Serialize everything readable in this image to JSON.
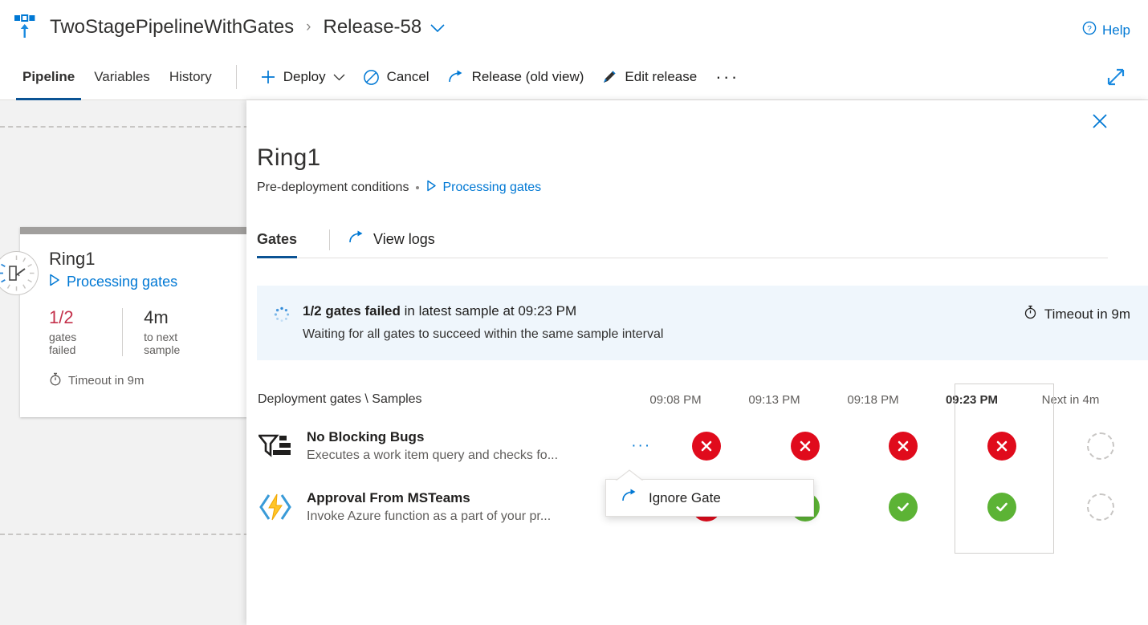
{
  "header": {
    "pipeline_icon": "release-pipeline-icon",
    "pipeline_name": "TwoStagePipelineWithGates",
    "separator": "›",
    "release_name": "Release-58",
    "help_label": "Help",
    "help_icon": "question-circle-icon"
  },
  "toolbar": {
    "tabs": [
      {
        "label": "Pipeline",
        "active": true
      },
      {
        "label": "Variables",
        "active": false
      },
      {
        "label": "History",
        "active": false
      }
    ],
    "buttons": [
      {
        "label": "Deploy",
        "icon": "plus-icon",
        "has_chevron": true
      },
      {
        "label": "Cancel",
        "icon": "cancel-circle-icon",
        "has_chevron": false
      },
      {
        "label": "Release (old view)",
        "icon": "arrow-redo-icon",
        "has_chevron": false
      },
      {
        "label": "Edit release",
        "icon": "pencil-icon",
        "has_chevron": false
      }
    ],
    "overflow_label": "···",
    "expand_icon": "expand-diagonal-icon"
  },
  "stage_card": {
    "badge_icon": "gate-processing-icon",
    "title": "Ring1",
    "status_label": "Processing gates",
    "status_icon": "play-triangle-icon",
    "metrics": [
      {
        "value": "1/2",
        "label": "gates failed",
        "tone": "red"
      },
      {
        "value": "4m",
        "label": "to next sample",
        "tone": "plain"
      }
    ],
    "timeout_icon": "timer-icon",
    "timeout_label": "Timeout in 9m"
  },
  "panel": {
    "close_icon": "close-icon",
    "title": "Ring1",
    "subtitle": "Pre-deployment conditions",
    "subtitle_link": "Processing gates",
    "subtitle_link_icon": "play-triangle-icon",
    "tabs": [
      {
        "label": "Gates",
        "active": true
      }
    ],
    "view_logs_label": "View logs",
    "view_logs_icon": "arrow-redo-icon",
    "banner": {
      "spinner_icon": "loading-spinner-icon",
      "headline_bold": "1/2 gates failed",
      "headline_rest": " in latest sample at 09:23 PM",
      "subline": "Waiting for all gates to succeed within the same sample interval",
      "timeout_icon": "timer-icon",
      "timeout_label": "Timeout in 9m",
      "background_color": "#eff6fc"
    },
    "table": {
      "row_header_label": "Deployment gates \\ Samples",
      "columns": [
        {
          "label": "09:08 PM",
          "current": false
        },
        {
          "label": "09:13 PM",
          "current": false
        },
        {
          "label": "09:18 PM",
          "current": false
        },
        {
          "label": "09:23 PM",
          "current": true
        },
        {
          "label": "Next in 4m",
          "current": false
        }
      ],
      "rows": [
        {
          "icon": "work-item-query-funnel-icon",
          "name": "No Blocking Bugs",
          "description": "Executes a work item query and checks fo...",
          "more_label": "···",
          "samples": [
            "fail",
            "fail",
            "fail",
            "fail",
            "pending"
          ]
        },
        {
          "icon": "azure-function-icon",
          "name": "Approval From MSTeams",
          "description": "Invoke Azure function as a part of your pr...",
          "more_label": "···",
          "samples": [
            "fail",
            "pass",
            "pass",
            "pass",
            "pending"
          ]
        }
      ]
    },
    "callout": {
      "icon": "arrow-redo-icon",
      "label": "Ignore Gate"
    }
  },
  "colors": {
    "accent": "#0078d4",
    "tab_underline": "#0b5394",
    "fail": "#e00b1c",
    "pass": "#5cb335",
    "red_text": "#c4314b",
    "canvas": "#f2f2f2"
  }
}
